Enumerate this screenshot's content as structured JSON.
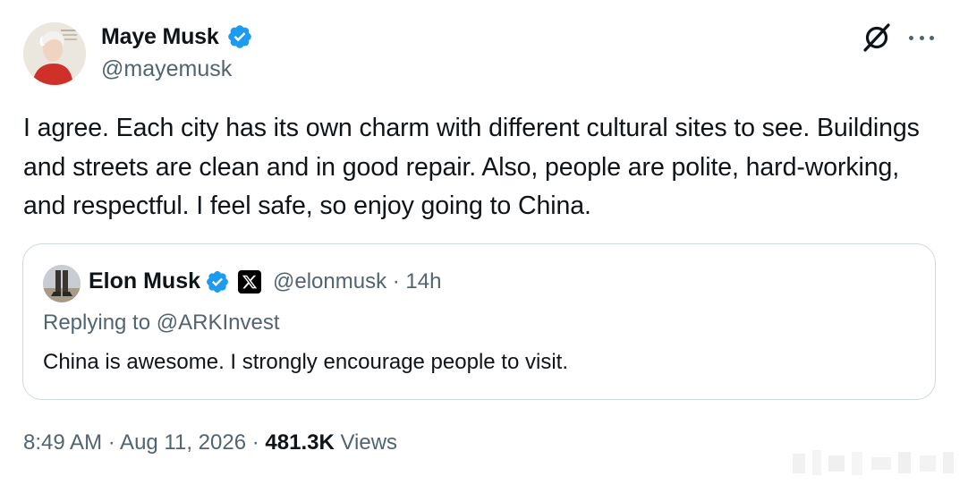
{
  "author": {
    "display_name": "Maye Musk",
    "handle": "@mayemusk"
  },
  "tweet": {
    "text": "I agree. Each city has its own charm with different cultural sites to see. Buildings and streets are clean and in good repair. Also, people are polite, hard-working, and respectful. I feel safe, so enjoy going to China."
  },
  "quote": {
    "display_name": "Elon Musk",
    "handle_time": "@elonmusk · 14h",
    "replying_to": "Replying to @ARKInvest",
    "text": "China is awesome. I strongly encourage people to visit."
  },
  "meta": {
    "time_date": "8:49 AM · Aug 11, 2026 · ",
    "views_count": "481.3K",
    "views_label": " Views"
  },
  "colors": {
    "verified": "#1d9bf0",
    "text_primary": "#0f1419",
    "text_secondary": "#536471",
    "border": "#cfd9de"
  },
  "icons": [
    "verified-badge-icon",
    "grok-icon",
    "more-options-icon",
    "x-logo-icon"
  ]
}
